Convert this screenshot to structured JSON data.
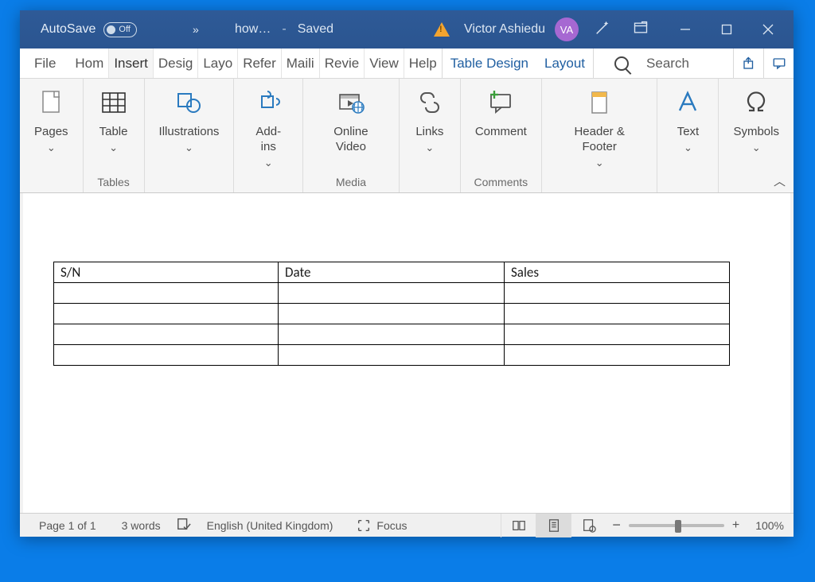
{
  "titlebar": {
    "autosave_label": "AutoSave",
    "autosave_state": "Off",
    "doc_name": "how…",
    "save_status": "Saved",
    "user_name": "Victor Ashiedu",
    "user_initials": "VA"
  },
  "tabs": {
    "file": "File",
    "home": "Hom",
    "insert": "Insert",
    "design": "Desig",
    "layout": "Layo",
    "references": "Refer",
    "mailings": "Maili",
    "review": "Revie",
    "view": "View",
    "help": "Help",
    "table_design": "Table Design",
    "table_layout": "Layout",
    "search": "Search"
  },
  "ribbon": {
    "pages": "Pages",
    "table": "Table",
    "illustrations": "Illustrations",
    "addins": "Add-ins",
    "online_video": "Online Video",
    "links": "Links",
    "comment": "Comment",
    "header_footer": "Header & Footer",
    "text": "Text",
    "symbols": "Symbols",
    "group_tables": "Tables",
    "group_media": "Media",
    "group_comments": "Comments"
  },
  "document": {
    "table": {
      "headers": [
        "S/N",
        "Date",
        "Sales"
      ],
      "rows": [
        [
          "",
          "",
          ""
        ],
        [
          "",
          "",
          ""
        ],
        [
          "",
          "",
          ""
        ],
        [
          "",
          "",
          ""
        ]
      ]
    }
  },
  "statusbar": {
    "page_info": "Page 1 of 1",
    "word_count": "3 words",
    "language": "English (United Kingdom)",
    "focus": "Focus",
    "zoom": "100%"
  }
}
